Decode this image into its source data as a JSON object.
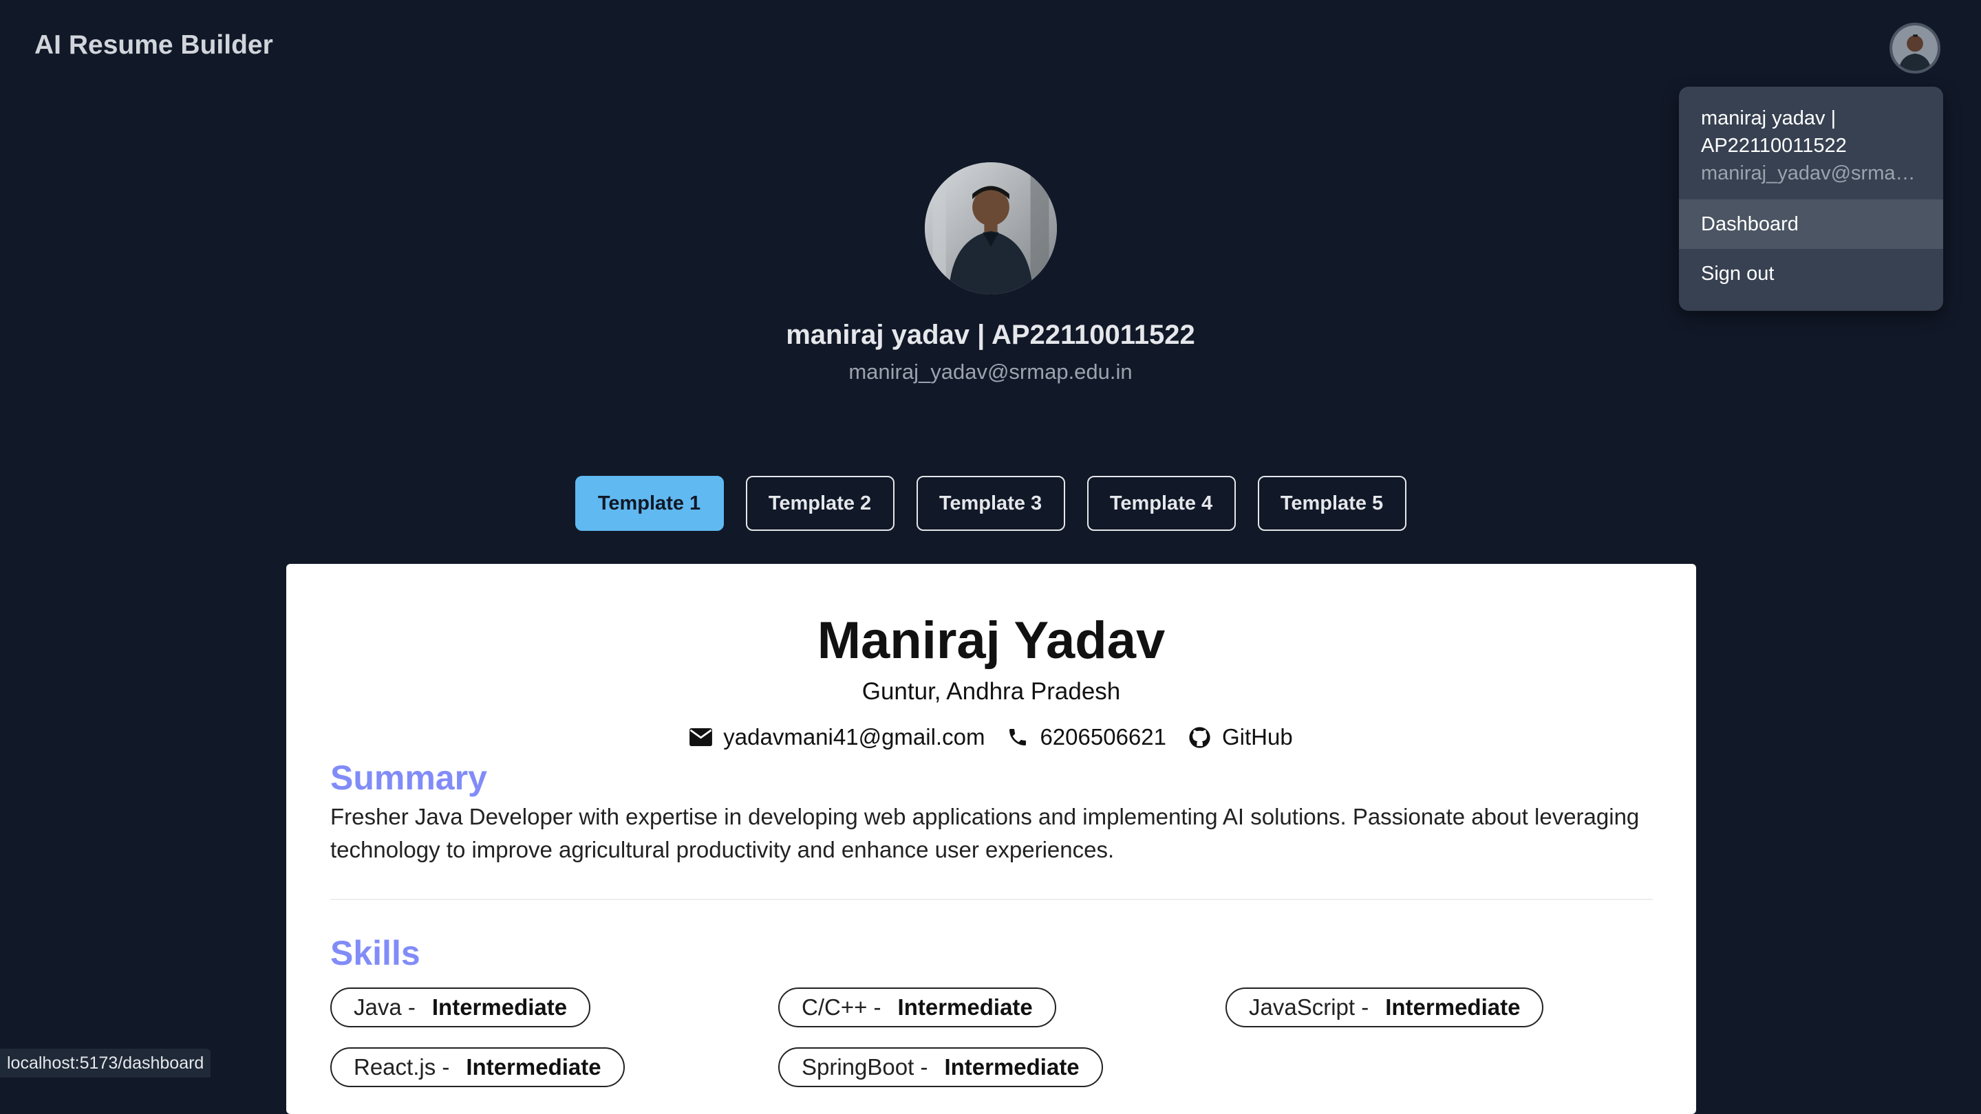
{
  "app": {
    "title": "AI Resume Builder"
  },
  "account_menu": {
    "name": "maniraj yadav | AP22110011522",
    "email": "maniraj_yadav@srmap.edu.in",
    "items": [
      {
        "label": "Dashboard",
        "active": true
      },
      {
        "label": "Sign out",
        "active": false
      }
    ]
  },
  "profile": {
    "name": "maniraj yadav | AP22110011522",
    "email": "maniraj_yadav@srmap.edu.in"
  },
  "templates": {
    "tabs": [
      {
        "label": "Template 1",
        "active": true
      },
      {
        "label": "Template 2",
        "active": false
      },
      {
        "label": "Template 3",
        "active": false
      },
      {
        "label": "Template 4",
        "active": false
      },
      {
        "label": "Template 5",
        "active": false
      }
    ]
  },
  "resume": {
    "name": "Maniraj Yadav",
    "location": "Guntur, Andhra Pradesh",
    "email": "yadavmani41@gmail.com",
    "phone": "6206506621",
    "github": "GitHub",
    "summary_title": "Summary",
    "summary": "Fresher Java Developer with expertise in developing web applications and implementing AI solutions. Passionate about leveraging technology to improve agricultural productivity and enhance user experiences.",
    "skills_title": "Skills",
    "skills": [
      {
        "name": "Java -",
        "level": "Intermediate"
      },
      {
        "name": "C/C++ -",
        "level": "Intermediate"
      },
      {
        "name": "JavaScript -",
        "level": "Intermediate"
      },
      {
        "name": "React.js -",
        "level": "Intermediate"
      },
      {
        "name": "SpringBoot -",
        "level": "Intermediate"
      }
    ]
  },
  "status_bar": {
    "url": "localhost:5173/dashboard"
  },
  "colors": {
    "background": "#111827",
    "menu": "#374151",
    "accent_tab": "#60b9f0",
    "section_title": "#818cf8"
  }
}
